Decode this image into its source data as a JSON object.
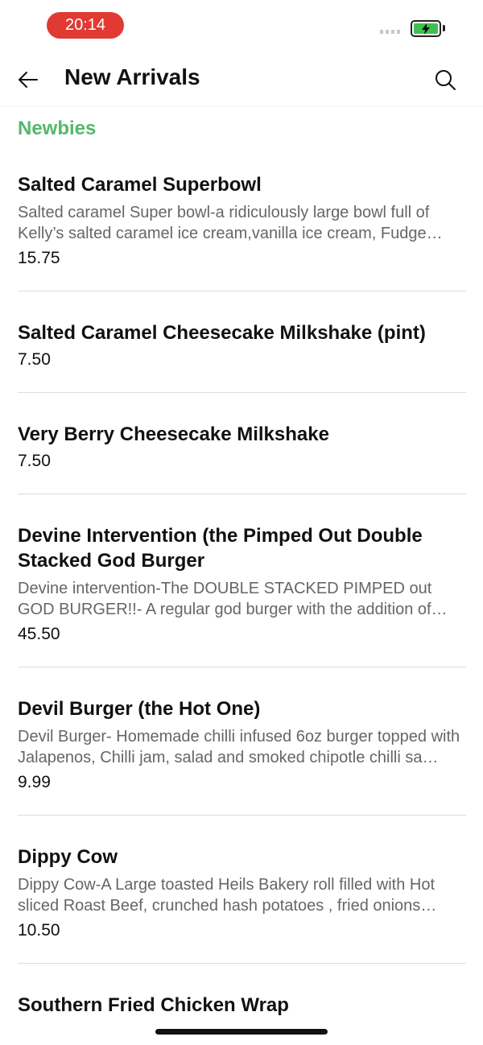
{
  "status_bar": {
    "time": "20:14",
    "accent_color": "#e03a32",
    "battery_color": "#3ec04e"
  },
  "header": {
    "back_icon": "arrow-left-icon",
    "title": "New Arrivals",
    "search_icon": "search-icon"
  },
  "section": {
    "title": "Newbies",
    "color": "#55b86b"
  },
  "items": [
    {
      "name": "Salted Caramel Superbowl",
      "description": "Salted caramel Super bowl-a ridiculously large bowl full of Kelly’s salted caramel ice cream,vanilla ice cream, Fudge pie…",
      "price": "15.75"
    },
    {
      "name": "Salted Caramel Cheesecake Milkshake (pint)",
      "description": "",
      "price": "7.50"
    },
    {
      "name": "Very Berry Cheesecake Milkshake",
      "description": "",
      "price": "7.50"
    },
    {
      "name": "Devine Intervention (the Pimped Out Double Stacked God Burger",
      "description": "Devine intervention-The DOUBLE STACKED PIMPED out GOD BURGER!!- A regular god burger with the addition of…",
      "price": "45.50"
    },
    {
      "name": "Devil Burger (the Hot One)",
      "description": "Devil Burger- Homemade chilli infused 6oz burger topped with Jalapenos, Chilli jam, salad and smoked chipotle chilli sa…",
      "price": "9.99"
    },
    {
      "name": "Dippy Cow",
      "description": "Dippy Cow-A Large toasted Heils Bakery roll filled with Hot sliced Roast Beef, crunched hash potatoes , fried onions and…",
      "price": "10.50"
    },
    {
      "name": "Southern Fried Chicken Wrap",
      "description": "",
      "price": ""
    }
  ]
}
